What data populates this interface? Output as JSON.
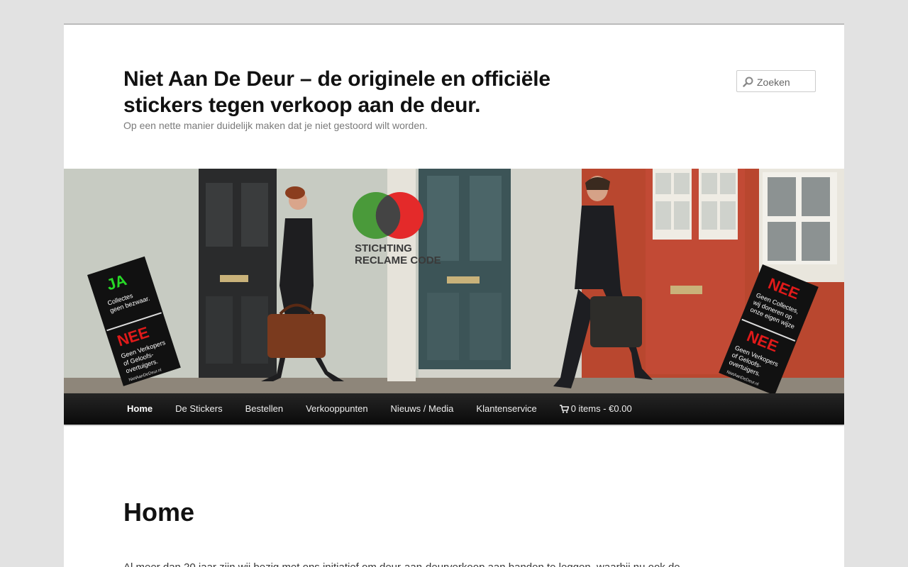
{
  "header": {
    "title": "Niet Aan De Deur – de originele en officiële stickers tegen verkoop aan de deur.",
    "description": "Op een nette manier duidelijk maken dat je niet gestoord wilt worden."
  },
  "search": {
    "placeholder": "Zoeken"
  },
  "banner": {
    "logo_line1": "STICHTING",
    "logo_line2": "RECLAME CODE",
    "sticker_left": {
      "ja": "JA",
      "ja_text": [
        "Collectes",
        "geen bezwaar."
      ],
      "nee": "NEE",
      "nee_text": [
        "Geen Verkopers",
        "of Geloofs-",
        "overtuigers."
      ],
      "site": "NietAanDeDeur.nl"
    },
    "sticker_right": {
      "nee1": "NEE",
      "nee1_text": [
        "Geen Collectes,",
        "wij doneren op",
        "onze eigen wijze"
      ],
      "nee2": "NEE",
      "nee2_text": [
        "Geen Verkopers",
        "of Geloofs-",
        "overtuigers."
      ],
      "site": "NietAanDeDeur.nl"
    }
  },
  "nav": {
    "items": [
      {
        "label": "Home",
        "current": true
      },
      {
        "label": "De Stickers"
      },
      {
        "label": "Bestellen"
      },
      {
        "label": "Verkooppunten"
      },
      {
        "label": "Nieuws / Media"
      },
      {
        "label": "Klantenservice"
      }
    ],
    "cart_label": "0 items - €0.00"
  },
  "content": {
    "title": "Home",
    "intro": "Al meer dan 20 jaar zijn wij bezig met ons initiatief om deur-aan-deurverkoop aan banden te leggen, waarbij nu ook de"
  },
  "colors": {
    "page_bg": "#e2e2e2",
    "nav_bg": "#111111",
    "sticker_green": "#27d827",
    "sticker_red": "#e01a1a"
  }
}
